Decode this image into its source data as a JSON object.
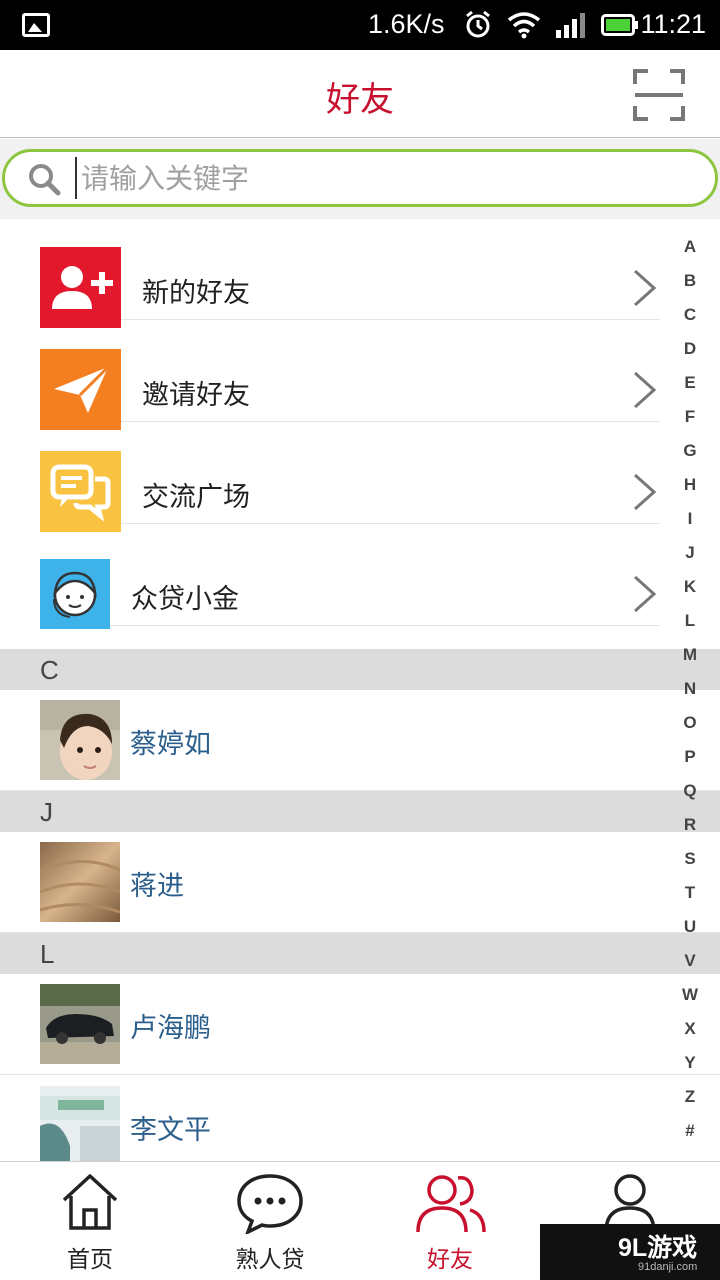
{
  "status_bar": {
    "network_speed": "1.6K/s",
    "time": "11:21"
  },
  "header": {
    "title": "好友"
  },
  "search": {
    "placeholder": "请输入关键字"
  },
  "menu": [
    {
      "label": "新的好友",
      "color": "#e3182d",
      "icon": "add-friend-icon"
    },
    {
      "label": "邀请好友",
      "color": "#f47f20",
      "icon": "paper-plane-icon"
    },
    {
      "label": "交流广场",
      "color": "#f9c241",
      "icon": "chat-bubbles-icon"
    },
    {
      "label": "众贷小金",
      "color": "#3eb3ea",
      "icon": "customer-service-icon"
    }
  ],
  "groups": [
    {
      "letter": "C",
      "contacts": [
        {
          "name": "蔡婷如"
        }
      ]
    },
    {
      "letter": "J",
      "contacts": [
        {
          "name": "蒋进"
        }
      ]
    },
    {
      "letter": "L",
      "contacts": [
        {
          "name": "卢海鹏"
        },
        {
          "name": "李文平"
        }
      ]
    }
  ],
  "alphabet_index": [
    "A",
    "B",
    "C",
    "D",
    "E",
    "F",
    "G",
    "H",
    "I",
    "J",
    "K",
    "L",
    "M",
    "N",
    "O",
    "P",
    "Q",
    "R",
    "S",
    "T",
    "U",
    "V",
    "W",
    "X",
    "Y",
    "Z",
    "#"
  ],
  "tabs": [
    {
      "label": "首页",
      "icon": "home-icon"
    },
    {
      "label": "熟人贷",
      "icon": "chat-dots-icon"
    },
    {
      "label": "好友",
      "icon": "friends-icon",
      "active": true
    },
    {
      "label": "",
      "icon": "profile-icon"
    }
  ],
  "watermark": {
    "logo": "9L游戏",
    "url": "91danji.com"
  },
  "colors": {
    "accent": "#c8102e",
    "search_border": "#8dc63f",
    "contact_name": "#2d5f8d"
  }
}
